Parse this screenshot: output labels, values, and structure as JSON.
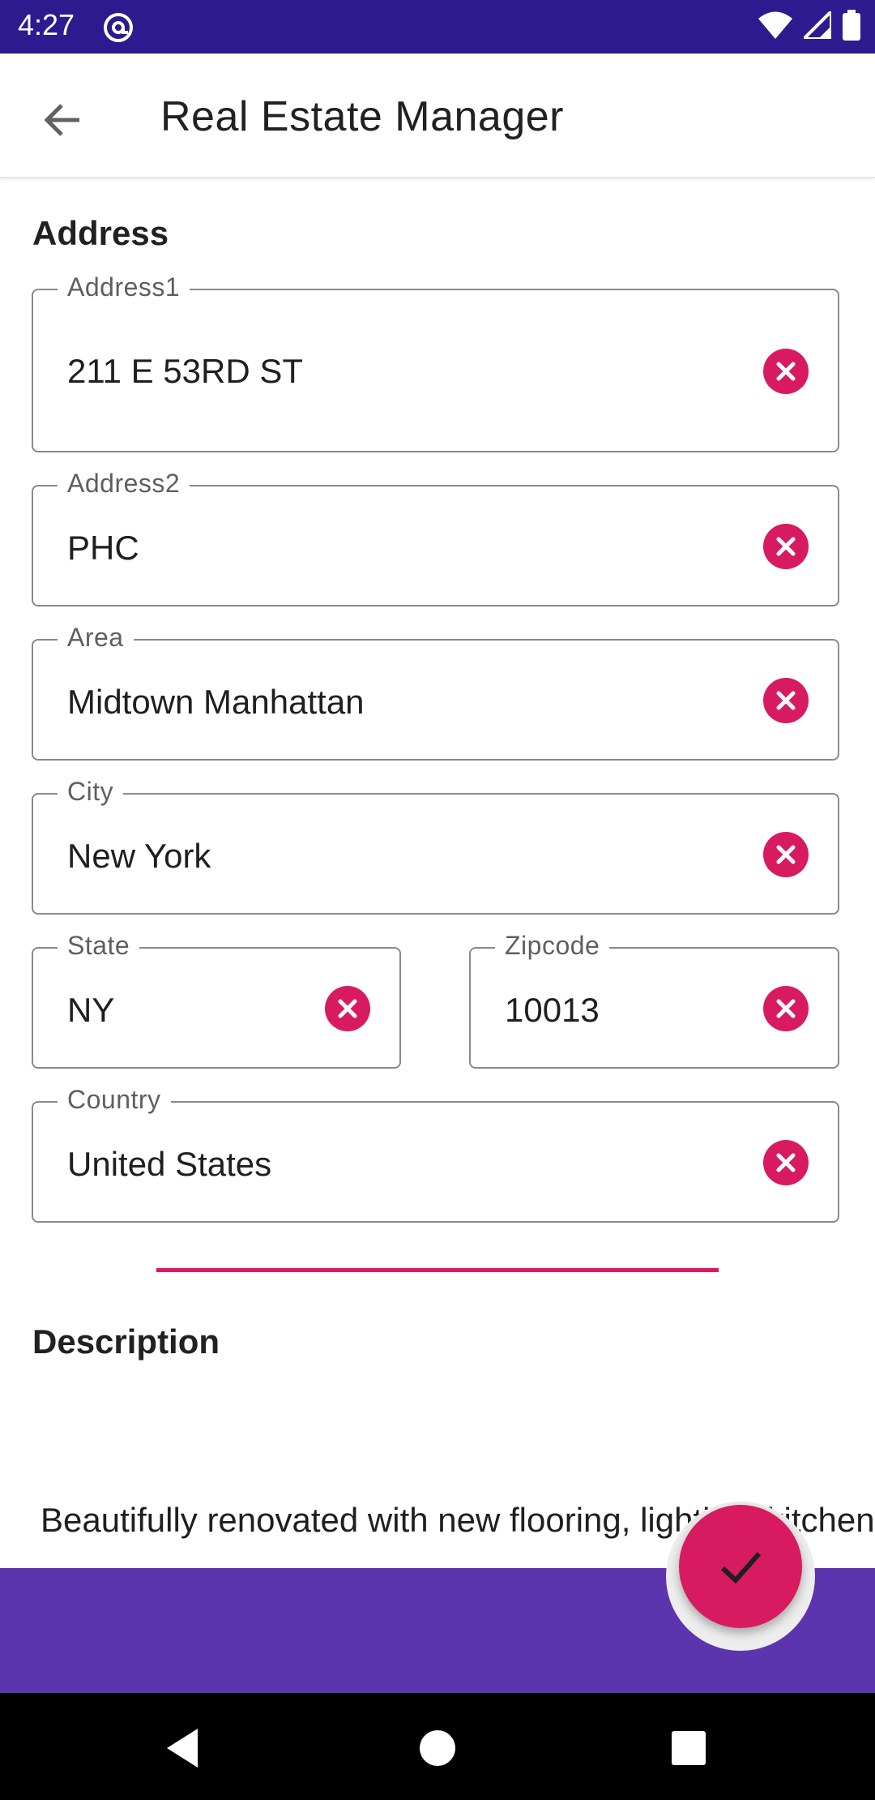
{
  "status_bar": {
    "time": "4:27"
  },
  "app_bar": {
    "title": "Real Estate Manager"
  },
  "address_section": {
    "heading": "Address",
    "fields": {
      "address1": {
        "label": "Address1",
        "value": "211 E 53RD ST"
      },
      "address2": {
        "label": "Address2",
        "value": "PHC"
      },
      "area": {
        "label": "Area",
        "value": "Midtown Manhattan"
      },
      "city": {
        "label": "City",
        "value": "New York"
      },
      "state": {
        "label": "State",
        "value": "NY"
      },
      "zipcode": {
        "label": "Zipcode",
        "value": "10013"
      },
      "country": {
        "label": "Country",
        "value": "United States"
      }
    }
  },
  "description_section": {
    "heading": "Description",
    "text": "Beautifully renovated with new flooring, lighting, kitchen and baths, as well as motorized shades, this unit also"
  },
  "icons": {
    "back": "arrow-back-icon",
    "clear": "cancel-icon",
    "fab": "check-icon"
  },
  "colors": {
    "status_bar": "#2e1a8f",
    "accent": "#d81b60",
    "bottom_bar": "#5c35ae"
  }
}
